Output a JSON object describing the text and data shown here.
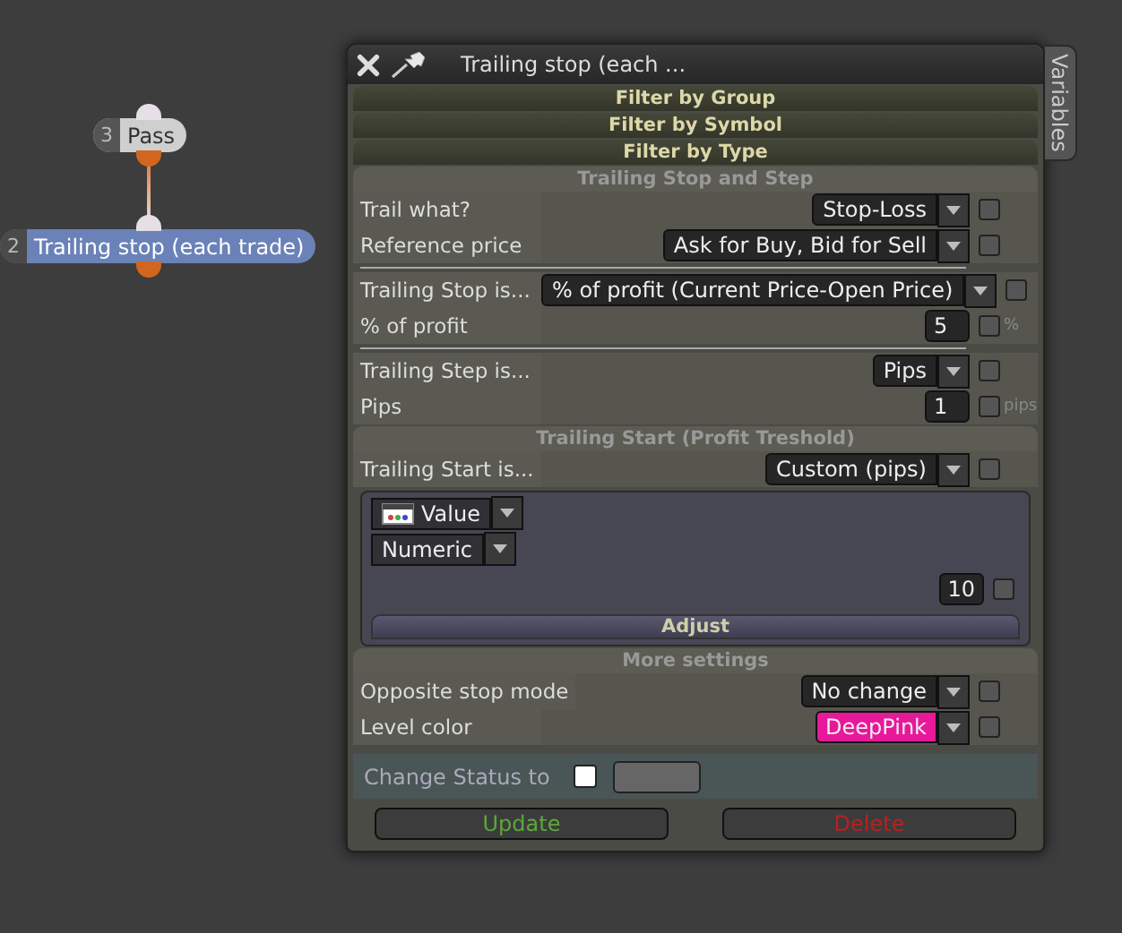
{
  "nodes": [
    {
      "number": "3",
      "label": "Pass",
      "selected": false
    },
    {
      "number": "2",
      "label": "Trailing stop (each trade)",
      "selected": true
    }
  ],
  "dialog": {
    "title": "Trailing stop (each ...",
    "side_tab": "Variables",
    "filters": [
      "Filter by Group",
      "Filter by Symbol",
      "Filter by Type"
    ],
    "sections": [
      {
        "title": "Trailing Stop and Step",
        "groups": [
          [
            {
              "kind": "dropdown",
              "label": "Trail what?",
              "value": "Stop-Loss",
              "checked": false
            },
            {
              "kind": "dropdown",
              "label": "Reference price",
              "value": "Ask for Buy, Bid for Sell",
              "checked": false
            }
          ],
          [
            {
              "kind": "dropdown",
              "label": "Trailing Stop is...",
              "value": "% of profit (Current Price-Open Price)",
              "checked": false
            },
            {
              "kind": "number",
              "label": "% of profit",
              "value": "5",
              "checked": false,
              "unit": "%"
            }
          ],
          [
            {
              "kind": "dropdown",
              "label": "Trailing Step is...",
              "value": "Pips",
              "checked": false
            },
            {
              "kind": "number",
              "label": "Pips",
              "value": "1",
              "checked": false,
              "unit": "pips"
            }
          ]
        ]
      },
      {
        "title": "Trailing Start (Profit Treshold)",
        "groups": [
          [
            {
              "kind": "dropdown",
              "label": "Trailing Start is...",
              "value": "Custom (pips)",
              "checked": false
            }
          ]
        ],
        "panel": {
          "source": "Value",
          "type": "Numeric",
          "value": "10",
          "checked": false,
          "button": "Adjust"
        }
      },
      {
        "title": "More settings",
        "groups": [
          [
            {
              "kind": "dropdown",
              "label": "Opposite stop mode",
              "value": "No change",
              "checked": false
            },
            {
              "kind": "dropdown",
              "label": "Level color",
              "value": "DeepPink",
              "checked": false,
              "color": "#e8189a"
            }
          ]
        ]
      }
    ],
    "status": {
      "label": "Change Status to",
      "checked": false
    },
    "buttons": [
      {
        "kind": "update",
        "label": "Update"
      },
      {
        "kind": "delete",
        "label": "Delete"
      }
    ]
  }
}
